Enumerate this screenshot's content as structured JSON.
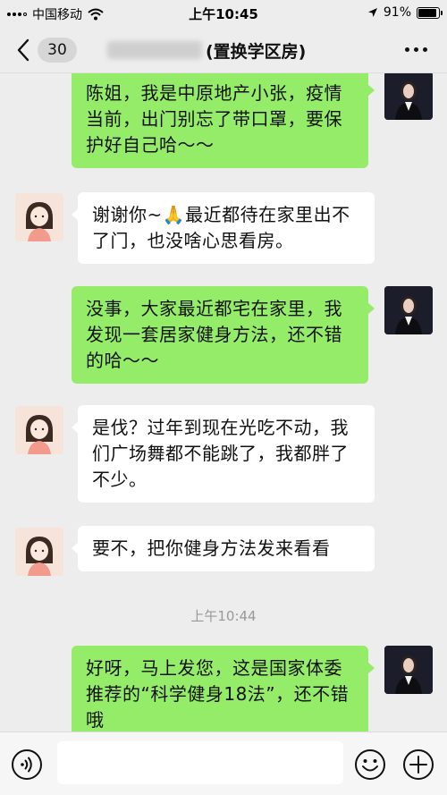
{
  "status_bar": {
    "carrier": "中国移动",
    "time": "上午10:45",
    "battery": "91%",
    "battery_level": 0.91,
    "icons": [
      "signal-icon",
      "wifi-icon",
      "location-icon",
      "battery-icon"
    ]
  },
  "header": {
    "unread_count": "30",
    "title": "(置换学区房)",
    "icons": [
      "back-chevron-icon",
      "more-icon"
    ]
  },
  "messages": [
    {
      "side": "out",
      "text": "陈姐，我是中原地产小张，疫情当前，出门别忘了带口罩，要保护好自己哈～～"
    },
    {
      "side": "in",
      "text": "谢谢你~🙏最近都待在家里出不了门，也没啥心思看房。"
    },
    {
      "side": "out",
      "text": "没事，大家最近都宅在家里，我发现一套居家健身方法，还不错的哈～～"
    },
    {
      "side": "in",
      "text": "是伐？过年到现在光吃不动，我们广场舞都不能跳了，我都胖了不少。"
    },
    {
      "side": "in",
      "text": "要不，把你健身方法发来看看"
    },
    {
      "side": "out",
      "text": "好呀，马上发您，这是国家体委推荐的“科学健身18法”，还不错哦"
    }
  ],
  "timestamp": "上午10:44",
  "input_bar": {
    "value": "",
    "icons": [
      "voice-icon",
      "emoji-icon",
      "plus-icon"
    ]
  },
  "colors": {
    "background": "#ededed",
    "outgoing_bubble": "#95ec69",
    "incoming_bubble": "#ffffff"
  }
}
